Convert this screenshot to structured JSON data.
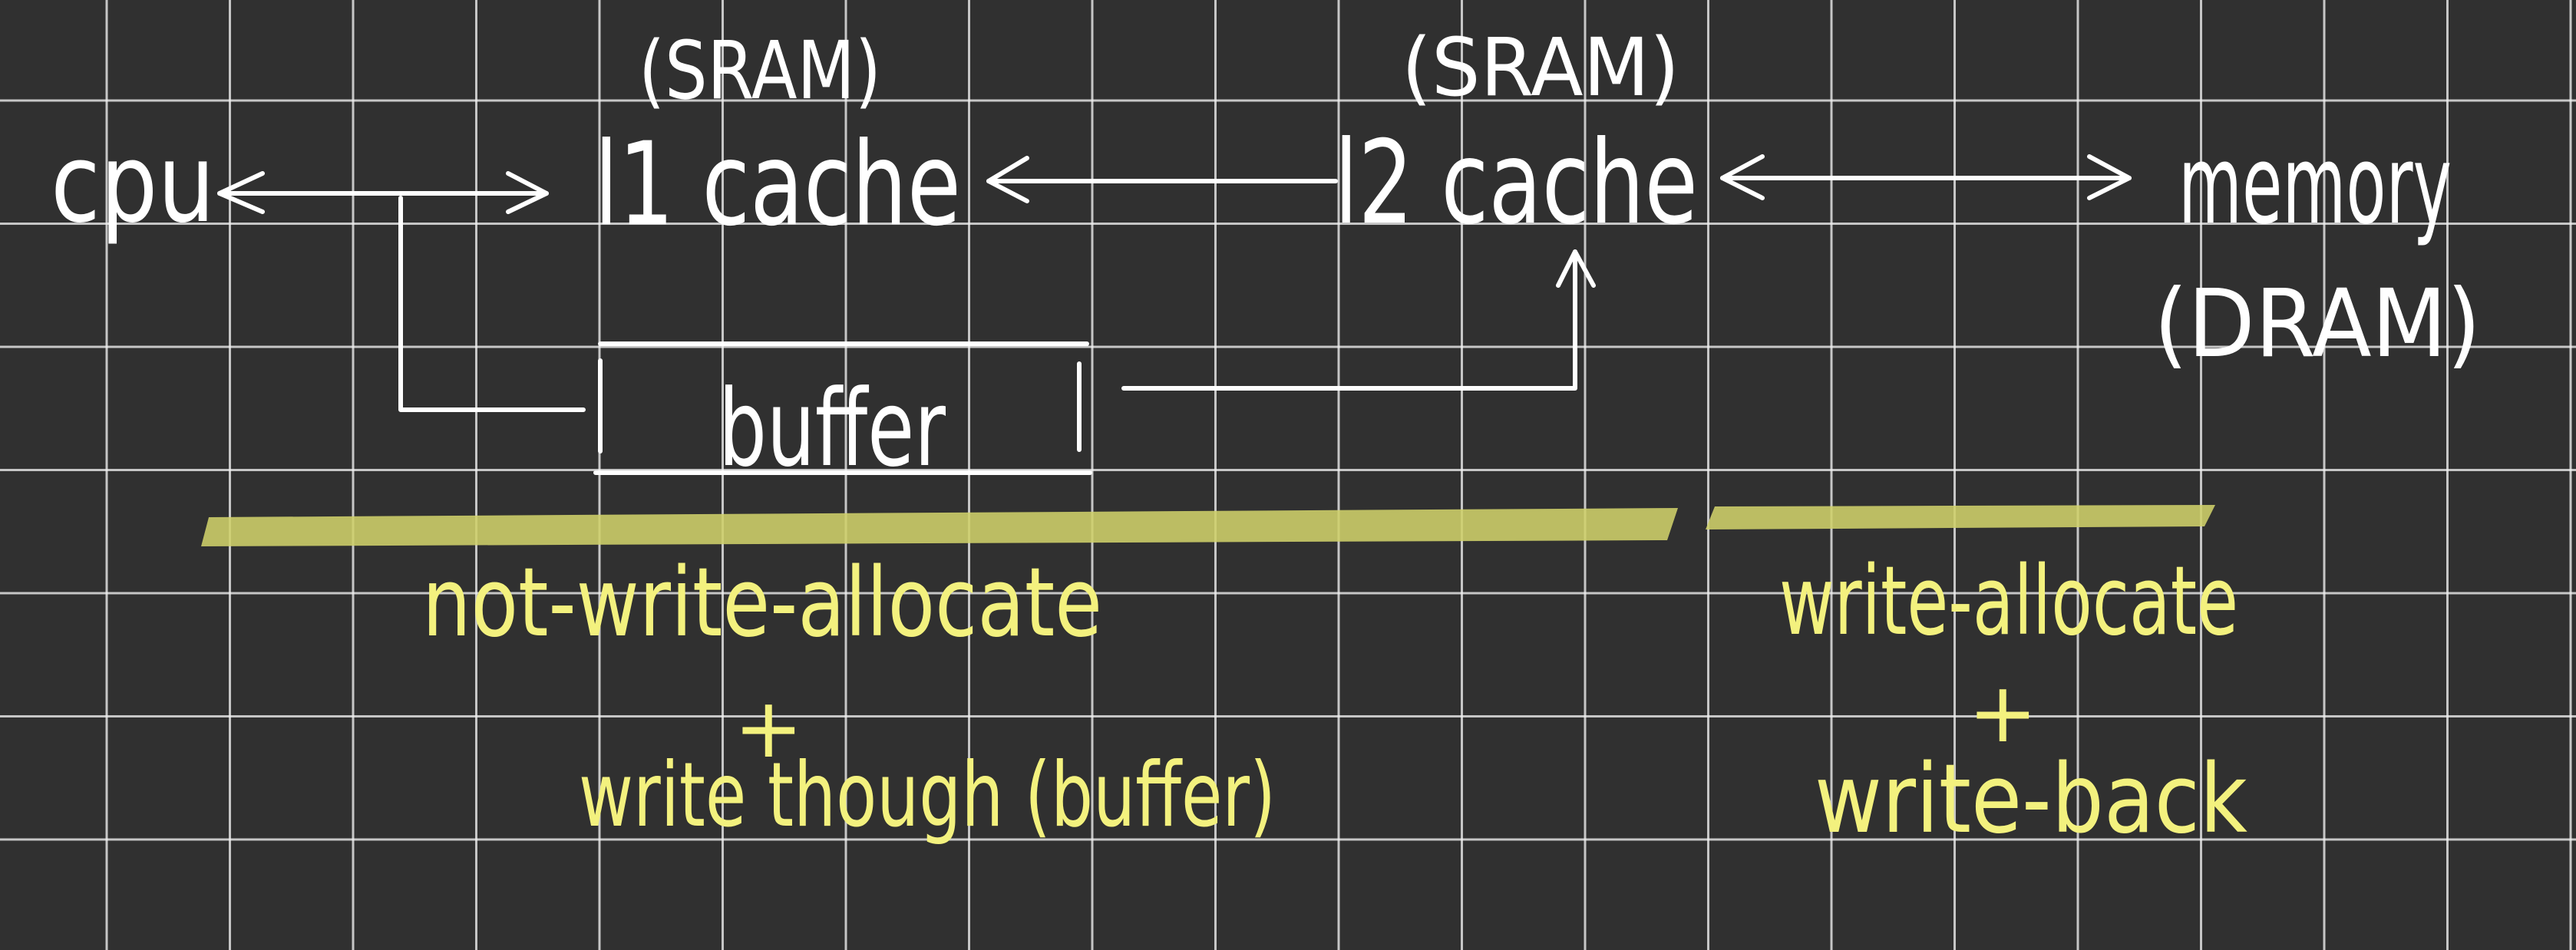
{
  "nodes": {
    "cpu": {
      "label": "cpu"
    },
    "l1": {
      "label": "l1 cache",
      "type": "(SRAM)"
    },
    "l2": {
      "label": "l2 cache",
      "type": "(SRAM)"
    },
    "memory": {
      "label": "memory",
      "type": "(DRAM)"
    },
    "buffer": {
      "label": "buffer"
    }
  },
  "policies": {
    "left": {
      "line1": "not-write-allocate",
      "plus": "+",
      "line2": "write though (buffer)"
    },
    "right": {
      "line1": "write-allocate",
      "plus": "+",
      "line2": "write-back"
    }
  },
  "colors": {
    "board_background": "#303030",
    "grid_line": "#f0f0f0",
    "ink_white": "#ffffff",
    "ink_yellow": "#f3f17e",
    "highlighter": "#cfd06a"
  }
}
